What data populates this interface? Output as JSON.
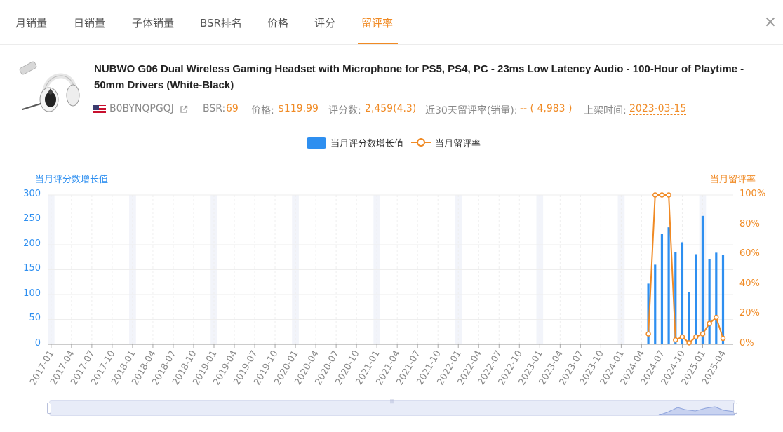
{
  "tabs": [
    {
      "label": "月销量"
    },
    {
      "label": "日销量"
    },
    {
      "label": "子体销量"
    },
    {
      "label": "BSR排名"
    },
    {
      "label": "价格"
    },
    {
      "label": "评分"
    },
    {
      "label": "留评率",
      "active": true
    }
  ],
  "close_icon": "close-icon",
  "product": {
    "title": "NUBWO G06 Dual Wireless Gaming Headset with Microphone for PS5, PS4, PC - 23ms Low Latency Audio - 100-Hour of Playtime - 50mm Drivers (White-Black)",
    "image_icon": "headset-product-image",
    "flag_icon": "us-flag-icon",
    "asin": "B0BYNQPGQJ",
    "external_link_icon": "external-link-icon",
    "bsr_label": "BSR:",
    "bsr_value": "69",
    "price_label": "价格:",
    "price_value": "$119.99",
    "reviews_label": "评分数:",
    "reviews_value": "2,459(4.3)",
    "review_rate_label": "近30天留评率(销量):",
    "review_rate_value": "-- ( 4,983 )",
    "launch_label": "上架时间:",
    "launch_value": "2023-03-15"
  },
  "colors": {
    "accent": "#f08a24",
    "bar": "#2e8ff0",
    "highlight_band": "#f2f4fa"
  },
  "chart_data": {
    "type": "bar",
    "legend": [
      "当月评分数增长值",
      "当月留评率"
    ],
    "left_axis_title": "当月评分数增长值",
    "right_axis_title": "当月留评率",
    "y_left_ticks": [
      "300",
      "250",
      "200",
      "150",
      "100",
      "50",
      "0"
    ],
    "y_right_ticks": [
      "100%",
      "80%",
      "60%",
      "40%",
      "20%",
      "0%"
    ],
    "ylim_left": [
      0,
      300
    ],
    "ylim_right": [
      0,
      100
    ],
    "x_start": "2017-01",
    "x_end": "2025-05",
    "x_tick_labels": [
      "2017-01",
      "2017-04",
      "2017-07",
      "2017-10",
      "2018-01",
      "2018-04",
      "2018-07",
      "2018-10",
      "2019-01",
      "2019-04",
      "2019-07",
      "2019-10",
      "2020-01",
      "2020-04",
      "2020-07",
      "2020-10",
      "2021-01",
      "2021-04",
      "2021-07",
      "2021-10",
      "2022-01",
      "2022-04",
      "2022-07",
      "2022-10",
      "2023-01",
      "2023-04",
      "2023-07",
      "2023-10",
      "2024-01",
      "2024-04",
      "2024-07",
      "2024-10",
      "2025-01",
      "2025-04"
    ],
    "bar_series": {
      "name": "当月评分数增长值",
      "x": [
        "2024-05",
        "2024-06",
        "2024-07",
        "2024-08",
        "2024-09",
        "2024-10",
        "2024-11",
        "2024-12",
        "2025-01",
        "2025-02",
        "2025-03",
        "2025-04",
        "2025-05"
      ],
      "values": [
        122,
        160,
        222,
        235,
        185,
        205,
        105,
        181,
        258,
        171,
        184,
        180,
        0
      ]
    },
    "line_series": {
      "name": "当月留评率",
      "x": [
        "2024-05",
        "2024-06",
        "2024-07",
        "2024-08",
        "2024-09",
        "2024-10",
        "2024-11",
        "2024-12",
        "2025-01",
        "2025-02",
        "2025-03",
        "2025-04",
        "2025-05"
      ],
      "values": [
        7,
        100,
        100,
        100,
        3,
        5,
        1,
        5,
        7,
        14,
        18,
        4,
        null
      ]
    },
    "grid": true,
    "legend_position": "top-center"
  },
  "zoom_slider": {
    "handle_left_icon": "slider-handle-left",
    "handle_right_icon": "slider-handle-right"
  }
}
